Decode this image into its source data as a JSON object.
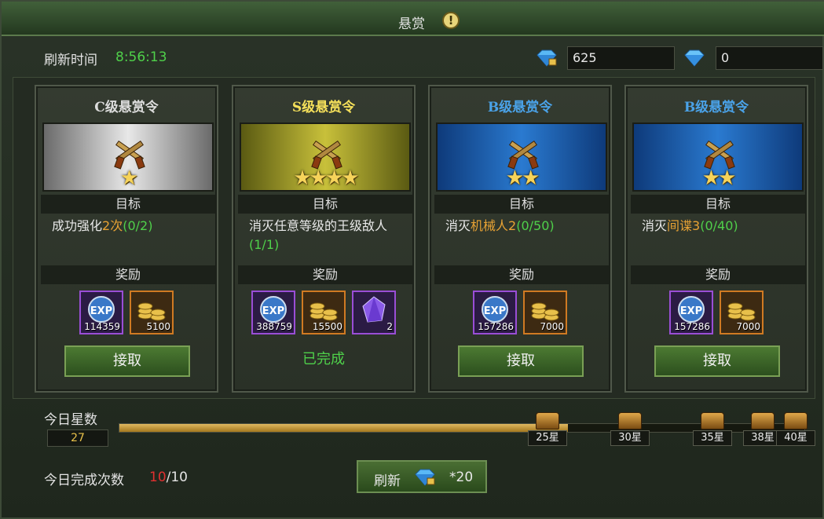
{
  "window": {
    "title": "悬赏"
  },
  "header": {
    "refresh_label": "刷新时间",
    "refresh_time": "8:56:13",
    "currency1": "625",
    "currency2": "0"
  },
  "labels": {
    "objective": "目标",
    "reward": "奖励",
    "accept": "接取",
    "completed": "已完成"
  },
  "cards": [
    {
      "title": "C级悬赏令",
      "title_color": "#dcdcdc",
      "banner": "silver",
      "stars": 1,
      "obj_pre": "成功强化",
      "obj_hl": "2次",
      "obj_progress": "(0/2)",
      "rewards": [
        {
          "icon": "exp-icon",
          "value": "114359"
        },
        {
          "icon": "gold-coins-icon",
          "value": "5100"
        }
      ],
      "status": "accept"
    },
    {
      "title": "S级悬赏令",
      "title_color": "#f5e05a",
      "banner": "gold",
      "stars": 4,
      "obj_pre": "消灭任意等级的王级敌人",
      "obj_hl": "",
      "obj_progress": "(1/1)",
      "rewards": [
        {
          "icon": "exp-icon",
          "value": "388759"
        },
        {
          "icon": "gold-coins-icon",
          "value": "15500"
        },
        {
          "icon": "purple-crystal-icon",
          "value": "2"
        }
      ],
      "status": "completed"
    },
    {
      "title": "B级悬赏令",
      "title_color": "#4aa2e8",
      "banner": "blue",
      "stars": 2,
      "obj_pre": "消灭",
      "obj_hl": "机械人2",
      "obj_progress": "(0/50)",
      "rewards": [
        {
          "icon": "exp-icon",
          "value": "157286"
        },
        {
          "icon": "gold-coins-icon",
          "value": "7000"
        }
      ],
      "status": "accept"
    },
    {
      "title": "B级悬赏令",
      "title_color": "#4aa2e8",
      "banner": "blue",
      "stars": 2,
      "obj_pre": "消灭",
      "obj_hl": "间谍3",
      "obj_progress": "(0/40)",
      "rewards": [
        {
          "icon": "exp-icon",
          "value": "157286"
        },
        {
          "icon": "gold-coins-icon",
          "value": "7000"
        }
      ],
      "status": "accept"
    }
  ],
  "daily": {
    "stars_label": "今日星数",
    "stars_value": "27",
    "progress_fraction": 0.655,
    "milestones": [
      "25星",
      "30星",
      "35星",
      "38星",
      "40星"
    ],
    "completion_label": "今日完成次数",
    "completion_done": "10",
    "completion_total": "/10",
    "refresh_button": "刷新",
    "refresh_cost": "*20"
  }
}
